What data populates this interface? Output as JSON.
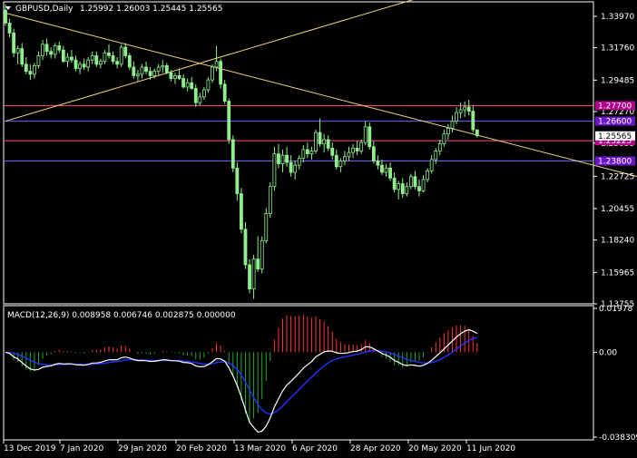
{
  "header": {
    "symbol": "GBPUSD,Daily",
    "ohlc": "1.25992 1.26003 1.25445 1.25565"
  },
  "macd_panel": {
    "title": "MACD(12,26,9) 0.008958 0.006746 0.002875 0.000000"
  },
  "colors": {
    "background": "#000000",
    "bull_candle": "#90ee90",
    "bear_candle": "#90ee90",
    "trendline": "#f5d27a",
    "line_red": "#ff4f8a",
    "line_blue": "#7b5cff",
    "macd_main": "#ffffff",
    "macd_signal": "#2233ff",
    "hist_pos": "#ff3333",
    "hist_neg": "#22aa22",
    "tag_magenta": "#b0008a",
    "tag_purple": "#6a16c8"
  },
  "chart_data": [
    {
      "type": "candlestick",
      "price_axis": [
        "1.33970",
        "1.31760",
        "1.29485",
        "1.27270",
        "1.25055",
        "1.22725",
        "1.20455",
        "1.18240",
        "1.15965",
        "1.13755"
      ],
      "ylim": [
        1.13755,
        1.3499
      ],
      "date_axis": [
        "13 Dec 2019",
        "7 Jan 2020",
        "29 Jan 2020",
        "20 Feb 2020",
        "13 Mar 2020",
        "6 Apr 2020",
        "28 Apr 2020",
        "20 May 2020",
        "11 Jun 2020"
      ],
      "horizontal_lines": [
        {
          "value": 1.277,
          "label": "1.27700",
          "color": "#ff4f8a"
        },
        {
          "value": 1.266,
          "label": "1.26600",
          "color": "#7b5cff"
        },
        {
          "value": 1.25225,
          "label": "1.25225",
          "color": "#ff4f8a"
        },
        {
          "value": 1.238,
          "label": "1.23800",
          "color": "#7b5cff"
        }
      ],
      "current_price": {
        "value": 1.25565,
        "label": "1.25565"
      },
      "candles": [
        [
          1.344,
          1.348,
          1.333,
          1.335
        ],
        [
          1.335,
          1.338,
          1.325,
          1.328
        ],
        [
          1.328,
          1.331,
          1.311,
          1.314
        ],
        [
          1.314,
          1.319,
          1.306,
          1.317
        ],
        [
          1.317,
          1.321,
          1.304,
          1.306
        ],
        [
          1.306,
          1.311,
          1.299,
          1.301
        ],
        [
          1.301,
          1.306,
          1.295,
          1.299
        ],
        [
          1.299,
          1.307,
          1.296,
          1.305
        ],
        [
          1.305,
          1.315,
          1.303,
          1.312
        ],
        [
          1.312,
          1.323,
          1.309,
          1.32
        ],
        [
          1.32,
          1.324,
          1.312,
          1.315
        ],
        [
          1.315,
          1.318,
          1.31,
          1.313
        ],
        [
          1.313,
          1.321,
          1.31,
          1.319
        ],
        [
          1.319,
          1.322,
          1.314,
          1.316
        ],
        [
          1.316,
          1.319,
          1.307,
          1.308
        ],
        [
          1.308,
          1.314,
          1.304,
          1.311
        ],
        [
          1.311,
          1.316,
          1.307,
          1.309
        ],
        [
          1.309,
          1.312,
          1.301,
          1.303
        ],
        [
          1.303,
          1.308,
          1.299,
          1.306
        ],
        [
          1.306,
          1.31,
          1.302,
          1.304
        ],
        [
          1.304,
          1.311,
          1.301,
          1.309
        ],
        [
          1.309,
          1.315,
          1.306,
          1.312
        ],
        [
          1.312,
          1.315,
          1.304,
          1.306
        ],
        [
          1.306,
          1.31,
          1.303,
          1.308
        ],
        [
          1.308,
          1.316,
          1.306,
          1.314
        ],
        [
          1.314,
          1.32,
          1.31,
          1.312
        ],
        [
          1.312,
          1.315,
          1.306,
          1.308
        ],
        [
          1.308,
          1.311,
          1.303,
          1.306
        ],
        [
          1.306,
          1.32,
          1.304,
          1.318
        ],
        [
          1.318,
          1.321,
          1.31,
          1.312
        ],
        [
          1.312,
          1.314,
          1.302,
          1.304
        ],
        [
          1.304,
          1.308,
          1.296,
          1.298
        ],
        [
          1.298,
          1.302,
          1.294,
          1.299
        ],
        [
          1.299,
          1.306,
          1.296,
          1.304
        ],
        [
          1.304,
          1.308,
          1.299,
          1.301
        ],
        [
          1.301,
          1.304,
          1.295,
          1.298
        ],
        [
          1.298,
          1.303,
          1.296,
          1.301
        ],
        [
          1.301,
          1.306,
          1.298,
          1.304
        ],
        [
          1.304,
          1.309,
          1.3,
          1.305
        ],
        [
          1.305,
          1.307,
          1.299,
          1.3
        ],
        [
          1.3,
          1.302,
          1.294,
          1.296
        ],
        [
          1.296,
          1.3,
          1.292,
          1.298
        ],
        [
          1.298,
          1.303,
          1.295,
          1.296
        ],
        [
          1.296,
          1.299,
          1.289,
          1.29
        ],
        [
          1.29,
          1.296,
          1.287,
          1.293
        ],
        [
          1.293,
          1.297,
          1.288,
          1.289
        ],
        [
          1.289,
          1.292,
          1.276,
          1.279
        ],
        [
          1.279,
          1.286,
          1.277,
          1.283
        ],
        [
          1.283,
          1.29,
          1.281,
          1.288
        ],
        [
          1.288,
          1.297,
          1.286,
          1.295
        ],
        [
          1.295,
          1.306,
          1.293,
          1.304
        ],
        [
          1.304,
          1.319,
          1.301,
          1.308
        ],
        [
          1.308,
          1.31,
          1.289,
          1.292
        ],
        [
          1.292,
          1.295,
          1.278,
          1.28
        ],
        [
          1.28,
          1.282,
          1.25,
          1.253
        ],
        [
          1.253,
          1.256,
          1.23,
          1.233
        ],
        [
          1.233,
          1.237,
          1.21,
          1.215
        ],
        [
          1.215,
          1.219,
          1.187,
          1.19
        ],
        [
          1.19,
          1.195,
          1.162,
          1.165
        ],
        [
          1.165,
          1.169,
          1.145,
          1.148
        ],
        [
          1.148,
          1.172,
          1.141,
          1.169
        ],
        [
          1.169,
          1.185,
          1.16,
          1.162
        ],
        [
          1.162,
          1.185,
          1.159,
          1.182
        ],
        [
          1.182,
          1.205,
          1.18,
          1.201
        ],
        [
          1.201,
          1.223,
          1.198,
          1.22
        ],
        [
          1.22,
          1.248,
          1.217,
          1.243
        ],
        [
          1.243,
          1.25,
          1.233,
          1.236
        ],
        [
          1.236,
          1.246,
          1.23,
          1.242
        ],
        [
          1.242,
          1.248,
          1.234,
          1.237
        ],
        [
          1.237,
          1.242,
          1.227,
          1.23
        ],
        [
          1.23,
          1.238,
          1.225,
          1.235
        ],
        [
          1.235,
          1.242,
          1.232,
          1.24
        ],
        [
          1.24,
          1.249,
          1.237,
          1.246
        ],
        [
          1.246,
          1.251,
          1.24,
          1.243
        ],
        [
          1.243,
          1.248,
          1.239,
          1.245
        ],
        [
          1.245,
          1.26,
          1.243,
          1.258
        ],
        [
          1.258,
          1.268,
          1.248,
          1.25
        ],
        [
          1.25,
          1.257,
          1.244,
          1.253
        ],
        [
          1.253,
          1.256,
          1.245,
          1.247
        ],
        [
          1.247,
          1.251,
          1.239,
          1.242
        ],
        [
          1.242,
          1.246,
          1.232,
          1.234
        ],
        [
          1.234,
          1.24,
          1.23,
          1.238
        ],
        [
          1.238,
          1.245,
          1.235,
          1.241
        ],
        [
          1.241,
          1.248,
          1.238,
          1.244
        ],
        [
          1.244,
          1.25,
          1.24,
          1.247
        ],
        [
          1.247,
          1.252,
          1.242,
          1.245
        ],
        [
          1.245,
          1.253,
          1.243,
          1.251
        ],
        [
          1.251,
          1.266,
          1.249,
          1.262
        ],
        [
          1.262,
          1.265,
          1.246,
          1.248
        ],
        [
          1.248,
          1.252,
          1.236,
          1.238
        ],
        [
          1.238,
          1.242,
          1.232,
          1.235
        ],
        [
          1.235,
          1.239,
          1.228,
          1.23
        ],
        [
          1.23,
          1.236,
          1.227,
          1.233
        ],
        [
          1.233,
          1.237,
          1.224,
          1.226
        ],
        [
          1.226,
          1.23,
          1.216,
          1.218
        ],
        [
          1.218,
          1.224,
          1.211,
          1.222
        ],
        [
          1.222,
          1.226,
          1.212,
          1.215
        ],
        [
          1.215,
          1.223,
          1.213,
          1.22
        ],
        [
          1.22,
          1.229,
          1.218,
          1.227
        ],
        [
          1.227,
          1.231,
          1.218,
          1.22
        ],
        [
          1.22,
          1.225,
          1.213,
          1.217
        ],
        [
          1.217,
          1.228,
          1.216,
          1.225
        ],
        [
          1.225,
          1.233,
          1.223,
          1.231
        ],
        [
          1.231,
          1.242,
          1.229,
          1.239
        ],
        [
          1.239,
          1.247,
          1.236,
          1.245
        ],
        [
          1.245,
          1.253,
          1.242,
          1.25
        ],
        [
          1.25,
          1.26,
          1.248,
          1.257
        ],
        [
          1.257,
          1.264,
          1.253,
          1.261
        ],
        [
          1.261,
          1.27,
          1.258,
          1.266
        ],
        [
          1.266,
          1.276,
          1.264,
          1.272
        ],
        [
          1.272,
          1.279,
          1.268,
          1.274
        ],
        [
          1.274,
          1.28,
          1.269,
          1.276
        ],
        [
          1.276,
          1.281,
          1.27,
          1.273
        ],
        [
          1.273,
          1.277,
          1.258,
          1.26
        ],
        [
          1.2599,
          1.26,
          1.2545,
          1.2557
        ]
      ],
      "trendlines": [
        {
          "from": [
            0,
            1.266
          ],
          "to": [
            113,
            1.364
          ]
        },
        {
          "from": [
            0,
            1.342
          ],
          "to": [
            182,
            1.205
          ]
        }
      ]
    },
    {
      "type": "macd",
      "params": "12,26,9",
      "y_axis": [
        "0.01978",
        "0.00",
        "-0.038309"
      ],
      "ylim": [
        -0.038309,
        0.01978
      ]
    }
  ]
}
